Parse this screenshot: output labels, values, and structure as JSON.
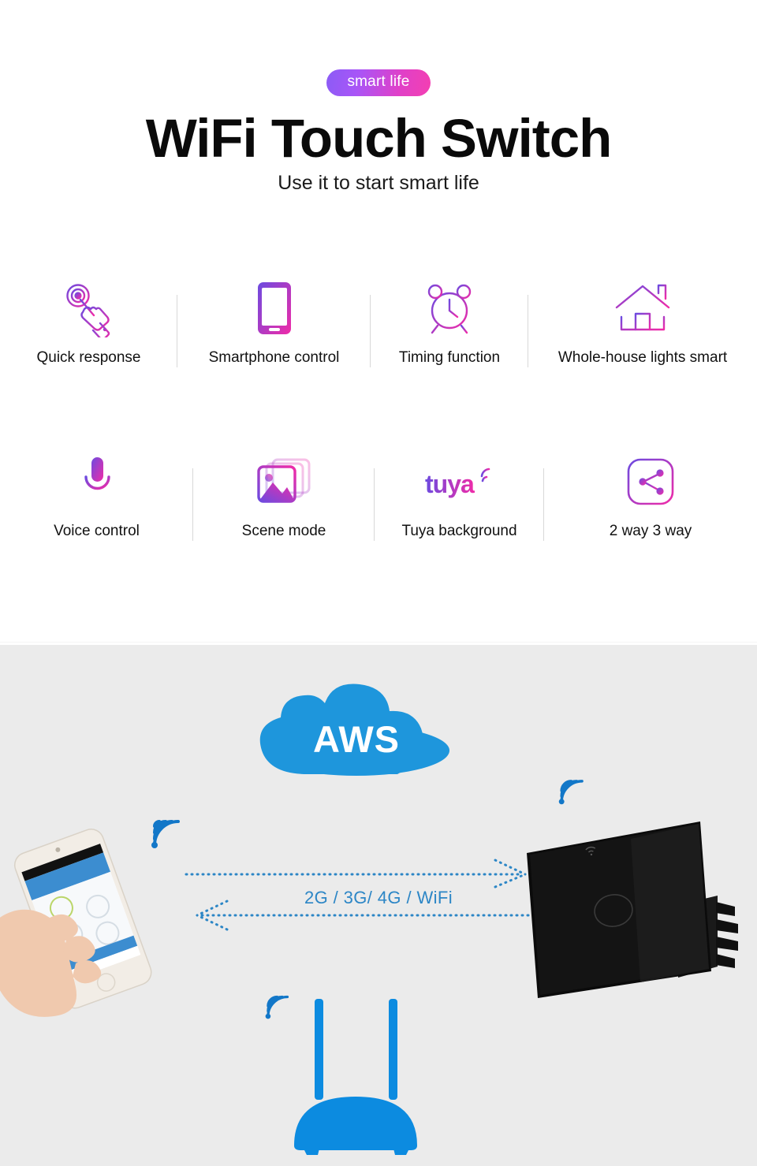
{
  "hero": {
    "badge": "smart life",
    "title": "WiFi Touch Switch",
    "subtitle": "Use it to start smart life",
    "badge_gradient_from": "#8B5CF6",
    "badge_gradient_to": "#F43FB1"
  },
  "features": {
    "row1": [
      {
        "label": "Quick response",
        "icon": "touch-hand-icon"
      },
      {
        "label": "Smartphone control",
        "icon": "smartphone-icon"
      },
      {
        "label": "Timing function",
        "icon": "alarm-clock-icon"
      },
      {
        "label": "Whole-house lights smart",
        "icon": "house-icon"
      }
    ],
    "row2": [
      {
        "label": "Voice control",
        "icon": "microphone-icon"
      },
      {
        "label": "Scene mode",
        "icon": "photo-stack-icon"
      },
      {
        "label": "Tuya background",
        "icon": "tuya-logo-icon"
      },
      {
        "label": "2 way 3 way",
        "icon": "share-nodes-icon"
      }
    ],
    "icon_gradient_from": "#6C4BE0",
    "icon_gradient_to": "#F02BA8"
  },
  "diagram": {
    "cloud_label": "AWS",
    "cloud_color": "#1E96DC",
    "connection_label": "2G / 3G/ 4G / WiFi",
    "link_color": "#2c86c6",
    "background": "#EBEBEB",
    "nodes": [
      {
        "name": "smartphone-in-hand",
        "icon": "phone-app-icon"
      },
      {
        "name": "wifi-touch-switch",
        "icon": "black-switch-panel-icon"
      },
      {
        "name": "wifi-router",
        "icon": "router-icon"
      }
    ]
  }
}
